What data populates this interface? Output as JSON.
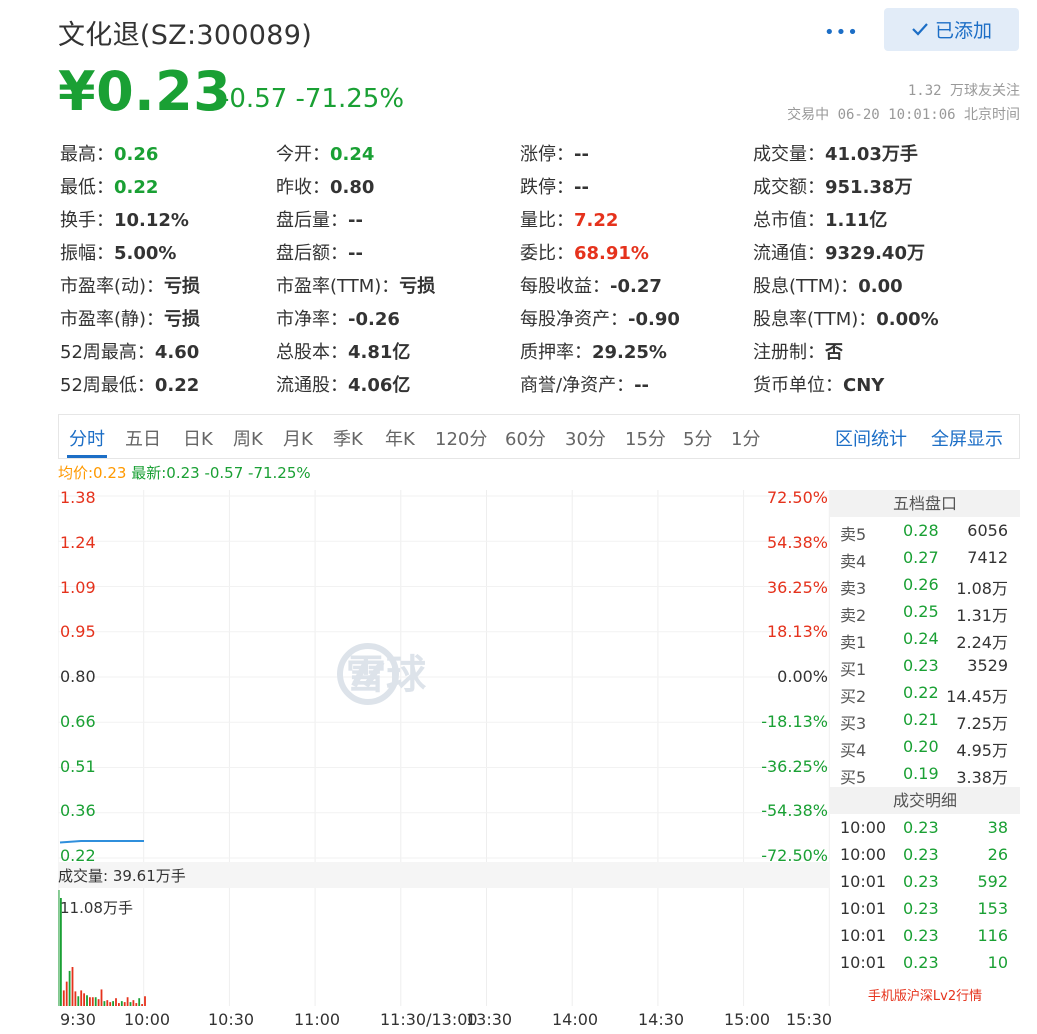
{
  "header": {
    "title": "文化退(SZ:300089)",
    "more_icon": "•••",
    "follow_button": "已添加",
    "price": "¥0.23",
    "change": "-0.57 -71.25%",
    "followers": "1.32 万球友关注",
    "trade_status": "交易中 06-20 10:01:06 北京时间"
  },
  "colors": {
    "down": "#1aa034",
    "up": "#e5321c",
    "accent": "#1c6ec6",
    "avg_line": "#ff9900"
  },
  "quote": {
    "rows": [
      [
        {
          "label": "最高：",
          "value": "0.26",
          "color": "green"
        },
        {
          "label": "今开：",
          "value": "0.24",
          "color": "green"
        },
        {
          "label": "涨停：",
          "value": "--",
          "color": ""
        },
        {
          "label": "成交量：",
          "value": "41.03万手",
          "color": ""
        }
      ],
      [
        {
          "label": "最低：",
          "value": "0.22",
          "color": "green"
        },
        {
          "label": "昨收：",
          "value": "0.80",
          "color": ""
        },
        {
          "label": "跌停：",
          "value": "--",
          "color": ""
        },
        {
          "label": "成交额：",
          "value": "951.38万",
          "color": ""
        }
      ],
      [
        {
          "label": "换手：",
          "value": "10.12%",
          "color": ""
        },
        {
          "label": "盘后量：",
          "value": "--",
          "color": ""
        },
        {
          "label": "量比：",
          "value": "7.22",
          "color": "red"
        },
        {
          "label": "总市值：",
          "value": "1.11亿",
          "color": ""
        }
      ],
      [
        {
          "label": "振幅：",
          "value": "5.00%",
          "color": ""
        },
        {
          "label": "盘后额：",
          "value": "--",
          "color": ""
        },
        {
          "label": "委比：",
          "value": "68.91%",
          "color": "red"
        },
        {
          "label": "流通值：",
          "value": "9329.40万",
          "color": ""
        }
      ],
      [
        {
          "label": "市盈率(动)：",
          "value": "亏损",
          "color": ""
        },
        {
          "label": "市盈率(TTM)：",
          "value": "亏损",
          "color": ""
        },
        {
          "label": "每股收益：",
          "value": "-0.27",
          "color": ""
        },
        {
          "label": "股息(TTM)：",
          "value": "0.00",
          "color": ""
        }
      ],
      [
        {
          "label": "市盈率(静)：",
          "value": "亏损",
          "color": ""
        },
        {
          "label": "市净率：",
          "value": "-0.26",
          "color": ""
        },
        {
          "label": "每股净资产：",
          "value": "-0.90",
          "color": ""
        },
        {
          "label": "股息率(TTM)：",
          "value": "0.00%",
          "color": ""
        }
      ],
      [
        {
          "label": "52周最高：",
          "value": "4.60",
          "color": ""
        },
        {
          "label": "总股本：",
          "value": "4.81亿",
          "color": ""
        },
        {
          "label": "质押率：",
          "value": "29.25%",
          "color": ""
        },
        {
          "label": "注册制：",
          "value": "否",
          "color": ""
        }
      ],
      [
        {
          "label": "52周最低：",
          "value": "0.22",
          "color": ""
        },
        {
          "label": "流通股：",
          "value": "4.06亿",
          "color": ""
        },
        {
          "label": "商誉/净资产：",
          "value": "--",
          "color": ""
        },
        {
          "label": "货币单位：",
          "value": "CNY",
          "color": ""
        }
      ]
    ]
  },
  "tabs": {
    "items": [
      "分时",
      "五日",
      "日K",
      "周K",
      "月K",
      "季K",
      "年K",
      "120分",
      "60分",
      "30分",
      "15分",
      "5分",
      "1分"
    ],
    "active": 0,
    "right": [
      "区间统计",
      "全屏显示"
    ]
  },
  "legend": {
    "avg": "均价:0.23",
    "latest": "最新:0.23 -0.57 -71.25%"
  },
  "chart_data": {
    "type": "line",
    "price_ticks": [
      "1.38",
      "1.24",
      "1.09",
      "0.95",
      "0.80",
      "0.66",
      "0.51",
      "0.36",
      "0.22"
    ],
    "pct_ticks": [
      "72.50%",
      "54.38%",
      "36.25%",
      "18.13%",
      "0.00%",
      "-18.13%",
      "-36.25%",
      "-54.38%",
      "-72.50%"
    ],
    "x_ticks": [
      "9:30",
      "10:00",
      "10:30",
      "11:00",
      "11:30/13:00",
      "13:30",
      "14:00",
      "14:30",
      "15:00",
      "15:30"
    ],
    "ylim": [
      0.22,
      1.38
    ],
    "series": [
      {
        "name": "最新",
        "x": [
          "9:30",
          "9:40",
          "9:50",
          "10:00",
          "10:01"
        ],
        "values": [
          0.225,
          0.23,
          0.23,
          0.23,
          0.23
        ]
      }
    ],
    "volume_label": "成交量: 39.61万手",
    "volume_max_label": "11.08万手",
    "volume_max": 11.08,
    "volume": [
      11.08,
      1.6,
      2.5,
      3.6,
      4.0,
      1.5,
      1.0,
      1.6,
      1.3,
      1.1,
      0.9,
      0.9,
      0.9,
      0.7,
      1.7,
      0.5,
      0.6,
      0.4,
      0.5,
      0.8,
      0.3,
      0.5,
      0.4,
      0.9,
      0.4,
      0.6,
      0.3,
      0.8,
      0.2,
      1.0
    ]
  },
  "watermark": {
    "text": "雪球"
  },
  "orderbook": {
    "title": "五档盘口",
    "asks": [
      {
        "name": "卖5",
        "price": "0.28",
        "volume": "6056"
      },
      {
        "name": "卖4",
        "price": "0.27",
        "volume": "7412"
      },
      {
        "name": "卖3",
        "price": "0.26",
        "volume": "1.08万"
      },
      {
        "name": "卖2",
        "price": "0.25",
        "volume": "1.31万"
      },
      {
        "name": "卖1",
        "price": "0.24",
        "volume": "2.24万"
      }
    ],
    "bids": [
      {
        "name": "买1",
        "price": "0.23",
        "volume": "3529"
      },
      {
        "name": "买2",
        "price": "0.22",
        "volume": "14.45万"
      },
      {
        "name": "买3",
        "price": "0.21",
        "volume": "7.25万"
      },
      {
        "name": "买4",
        "price": "0.20",
        "volume": "4.95万"
      },
      {
        "name": "买5",
        "price": "0.19",
        "volume": "3.38万"
      }
    ],
    "trades_title": "成交明细",
    "trades": [
      {
        "time": "10:00",
        "price": "0.23",
        "volume": "38"
      },
      {
        "time": "10:00",
        "price": "0.23",
        "volume": "26"
      },
      {
        "time": "10:01",
        "price": "0.23",
        "volume": "592"
      },
      {
        "time": "10:01",
        "price": "0.23",
        "volume": "153"
      },
      {
        "time": "10:01",
        "price": "0.23",
        "volume": "116"
      },
      {
        "time": "10:01",
        "price": "0.23",
        "volume": "10"
      }
    ],
    "lv2_link": "手机版沪深Lv2行情"
  }
}
